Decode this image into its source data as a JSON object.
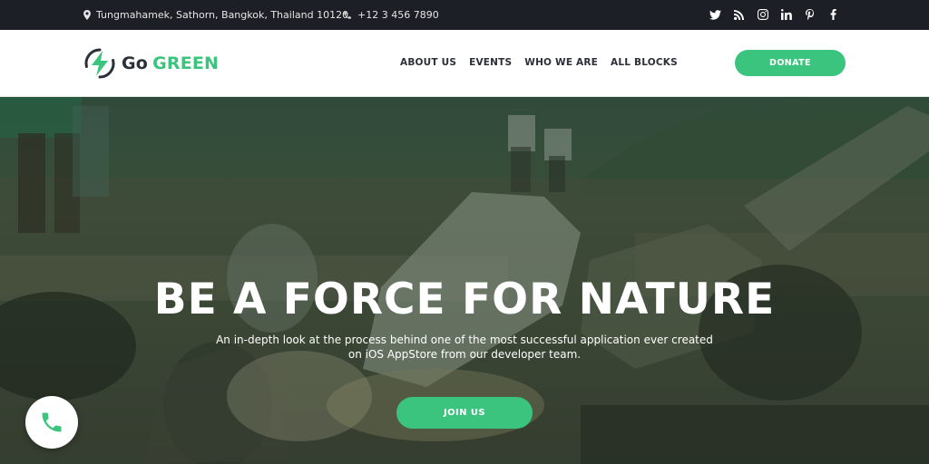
{
  "topbar": {
    "address": "Tungmahamek, Sathorn, Bangkok, Thailand 10120",
    "phone": "+12 3 456 7890",
    "address_icon": "map-pin-icon",
    "phone_icon": "phone-icon",
    "socials": [
      "twitter-icon",
      "rss-icon",
      "instagram-icon",
      "linkedin-icon",
      "pinterest-icon",
      "facebook-icon"
    ]
  },
  "header": {
    "logo_go": "Go",
    "logo_green": "GREEN",
    "nav": [
      "ABOUT US",
      "EVENTS",
      "WHO WE ARE",
      "ALL BLOCKS"
    ],
    "donate_label": "DONATE"
  },
  "hero": {
    "title": "BE A FORCE FOR NATURE",
    "subtitle": "An in-depth look at the process behind one of the most successful application ever created on iOS AppStore from our developer team.",
    "join_label": "JOIN US"
  },
  "floating": {
    "call_icon": "phone-call-icon"
  },
  "colors": {
    "accent": "#3ac47d",
    "topbar_bg": "#1d1f26",
    "text_dark": "#2c2f38"
  }
}
